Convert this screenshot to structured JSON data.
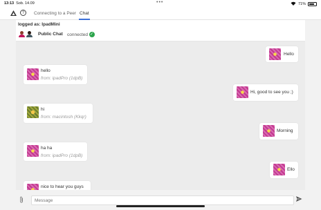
{
  "status": {
    "time": "13:13",
    "date": "Sob. 14.09",
    "dots": "•••",
    "battery": "71%",
    "battery_level": 0.71
  },
  "nav": {
    "tabs": [
      {
        "label": "Connecting to a Peer"
      },
      {
        "label": "Chat"
      }
    ],
    "help": "?"
  },
  "header": {
    "logged_as": "logged as: IpadMini",
    "room": "Public Chat",
    "status": "connected",
    "check": "✓"
  },
  "messages": [
    {
      "side": "right",
      "text": "Hello"
    },
    {
      "side": "left",
      "text": "hello",
      "from": "from: ipadPro (1dpB)"
    },
    {
      "side": "right",
      "text": "Hi, good to see you ;)"
    },
    {
      "side": "left",
      "text": "hi",
      "from": "from: macintosh (Kkqr)"
    },
    {
      "side": "right",
      "text": "Morning"
    },
    {
      "side": "left",
      "text": "ha ha",
      "from": "from: ipadPro (1dpB)"
    },
    {
      "side": "right",
      "text": "Ello"
    },
    {
      "side": "left",
      "text": "nice to hear you guys"
    }
  ],
  "composer": {
    "placeholder": "Message",
    "attach_icon": "paperclip-icon",
    "send_icon": "send-icon"
  },
  "colors": {
    "accent": "#3b6fd8",
    "connected": "#2ca44c"
  }
}
